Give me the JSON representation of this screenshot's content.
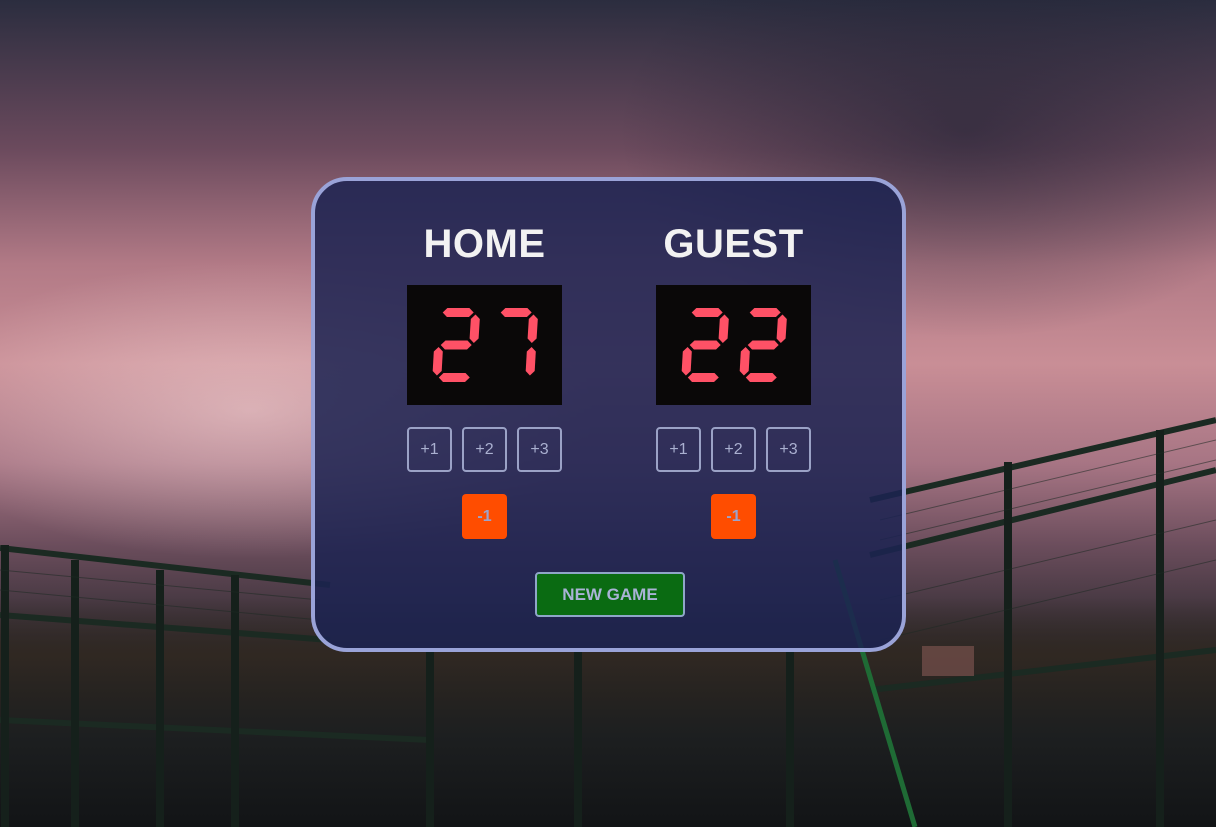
{
  "home": {
    "name": "HOME",
    "score": "27",
    "buttons": [
      "+1",
      "+2",
      "+3"
    ],
    "minus_label": "-1"
  },
  "guest": {
    "name": "GUEST",
    "score": "22",
    "buttons": [
      "+1",
      "+2",
      "+3"
    ],
    "minus_label": "-1"
  },
  "new_game_label": "NEW GAME",
  "colors": {
    "digit": "#ff5166",
    "minus_button": "#ff4d00",
    "new_game_button": "#0a6b12",
    "board_border": "#9aa3d8"
  }
}
